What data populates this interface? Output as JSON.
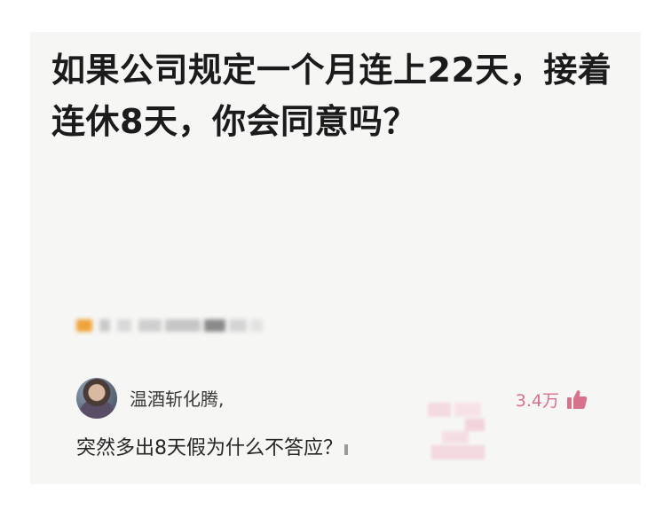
{
  "question": {
    "title": "如果公司规定一个月连上22天，接着连休8天，你会同意吗？"
  },
  "answer": {
    "username": "温酒斩化腾,",
    "like_count": "3.4万",
    "text": "突然多出8天假为什么不答应？"
  },
  "icons": {
    "like": "thumbs-up-icon",
    "avatar": "user-avatar"
  },
  "colors": {
    "like_accent": "#d8718c",
    "title_text": "#1b1b1b",
    "card_background": "#f6f6f4"
  }
}
